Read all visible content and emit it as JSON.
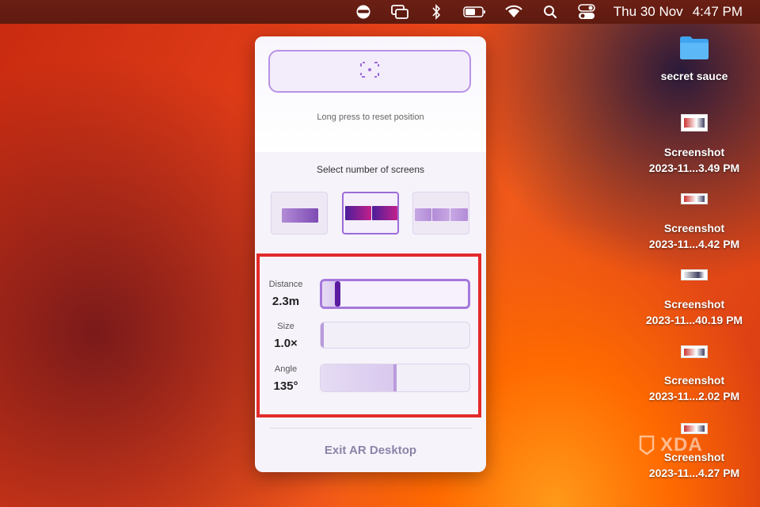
{
  "menubar": {
    "date": "Thu 30 Nov",
    "time": "4:47 PM",
    "icons": [
      "vpn-mask-icon",
      "screen-mirroring-icon",
      "bluetooth-icon",
      "battery-icon",
      "wifi-icon",
      "search-icon",
      "control-center-icon"
    ]
  },
  "panel": {
    "reset_hint": "Long press to reset position",
    "screens_title": "Select number of screens",
    "screen_options": [
      "one-screen",
      "two-screens",
      "three-screens"
    ],
    "selected_screens": 2,
    "sliders": [
      {
        "label": "Distance",
        "value": "2.3m",
        "level": 0.1
      },
      {
        "label": "Size",
        "value": "1.0×",
        "level": 0.0
      },
      {
        "label": "Angle",
        "value": "135°",
        "level": 0.5
      }
    ],
    "exit_label": "Exit AR Desktop"
  },
  "desktop": {
    "folder_name": "secret sauce",
    "files": [
      {
        "line1": "Screenshot",
        "line2": "2023-11...3.49 PM"
      },
      {
        "line1": "Screenshot",
        "line2": "2023-11...4.42 PM"
      },
      {
        "line1": "Screenshot",
        "line2": "2023-11...40.19 PM"
      },
      {
        "line1": "Screenshot",
        "line2": "2023-11...2.02 PM"
      },
      {
        "line1": "Screenshot",
        "line2": "2023-11...4.27 PM"
      }
    ]
  },
  "watermark": "XDA",
  "colors": {
    "accent": "#a678dc",
    "highlight": "#e32a2a",
    "thumb": "#5a1aa0"
  }
}
